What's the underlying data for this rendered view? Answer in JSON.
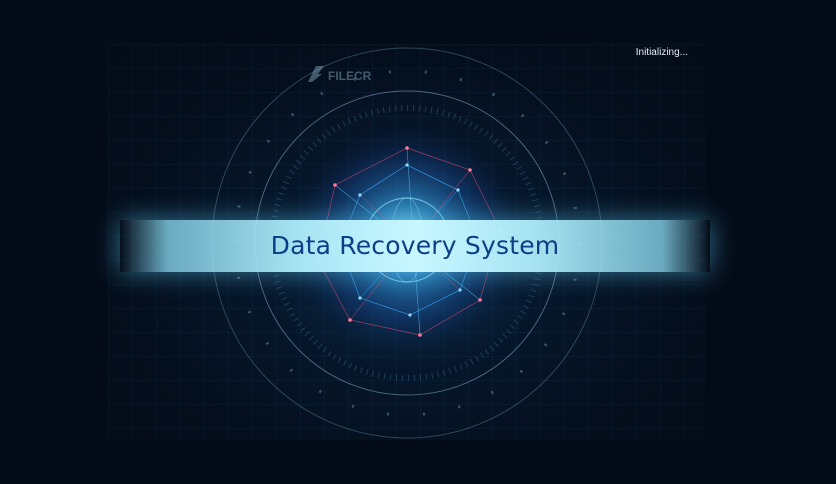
{
  "window": {
    "status_text": "Initializing...",
    "title": "Data Recovery System",
    "watermark_logo": "FILECR"
  },
  "colors": {
    "background": "#040b18",
    "banner_glow": "#bff3ff",
    "title_text": "#0d3f86",
    "network_blue": "#3ba6ff",
    "network_red": "#e0486a"
  },
  "icons": {
    "watermark": "filecr-logo-icon",
    "center_emblem": "network-globe-icon"
  }
}
